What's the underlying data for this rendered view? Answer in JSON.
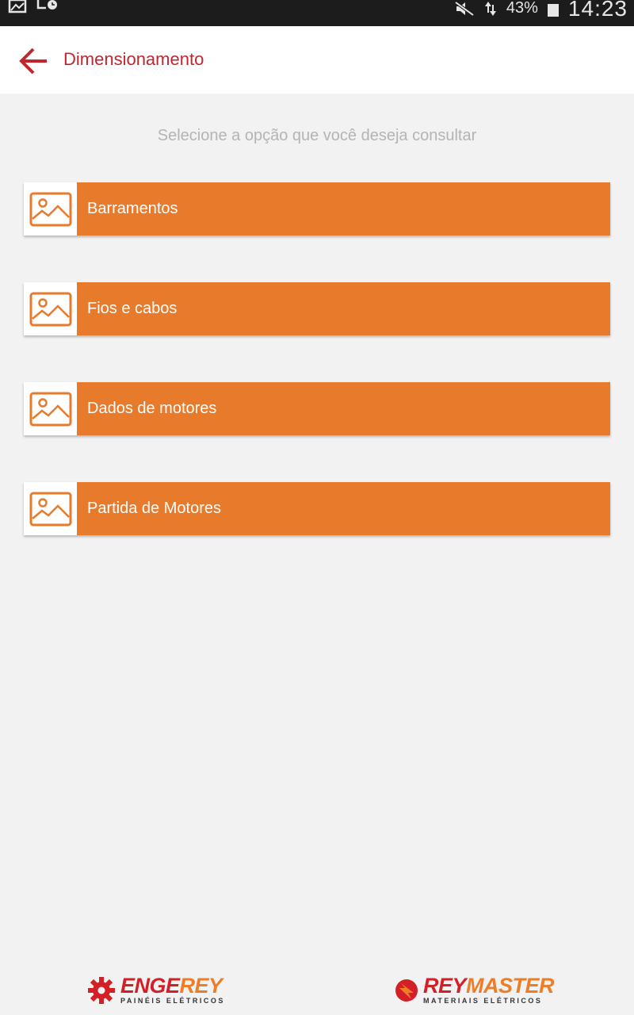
{
  "status_bar": {
    "battery_percent": "43%",
    "time": "14:23"
  },
  "app_bar": {
    "title": "Dimensionamento",
    "back_icon": "arrow-back-icon"
  },
  "instructions": "Selecione a opção que você deseja consultar",
  "menu": {
    "items": [
      {
        "label": "Barramentos",
        "icon": "image-placeholder-icon"
      },
      {
        "label": "Fios e cabos",
        "icon": "image-placeholder-icon"
      },
      {
        "label": "Dados de motores",
        "icon": "image-placeholder-icon"
      },
      {
        "label": "Partida de Motores",
        "icon": "image-placeholder-icon"
      }
    ]
  },
  "footer": {
    "engerey": {
      "brand_red": "ENGE",
      "brand_orange": "REY",
      "tagline": "PAINÉIS ELÉTRICOS"
    },
    "reymaster": {
      "brand_red": "REY",
      "brand_orange": "MASTER",
      "tagline": "MATERIAIS ELÉTRICOS"
    }
  },
  "colors": {
    "accent_red": "#c0262e",
    "accent_orange": "#e87a2c",
    "background": "#f2f2f2"
  }
}
